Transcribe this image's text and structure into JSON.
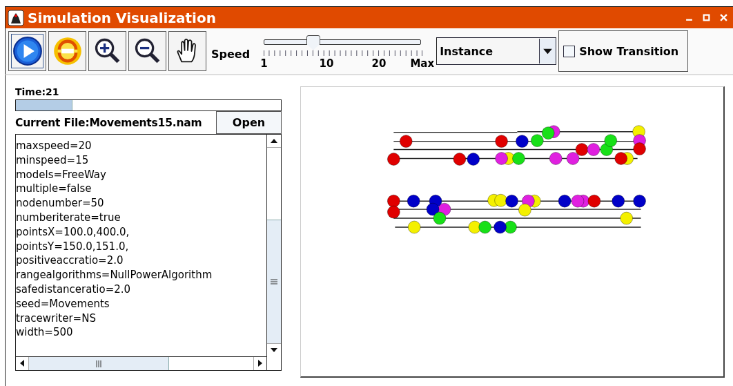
{
  "window": {
    "title": "Simulation Visualization"
  },
  "toolbar": {
    "speed_label": "Speed",
    "speed_slider": {
      "level": 0.31,
      "ticks": [
        "1",
        "10",
        "20",
        "Max"
      ]
    },
    "view_mode": {
      "value": "Instance"
    },
    "show_transition": {
      "label": "Show Transition",
      "checked": false
    }
  },
  "time": {
    "label": "Time:21",
    "level": 0.21
  },
  "current_file": {
    "label": "Current File:Movements15.nam",
    "button": "Open"
  },
  "config_lines": [
    "maxspeed=20",
    "minspeed=15",
    "models=FreeWay",
    "multiple=false",
    "nodenumber=50",
    "numberiterate=true",
    "pointsX=100.0,400.0,",
    "pointsY=150.0,151.0,",
    "positiveaccratio=2.0",
    "rangealgorithms=NullPowerAlgorithm",
    "safedistanceratio=2.0",
    "seed=Movements",
    "tracewriter=NS",
    "width=500"
  ]
}
